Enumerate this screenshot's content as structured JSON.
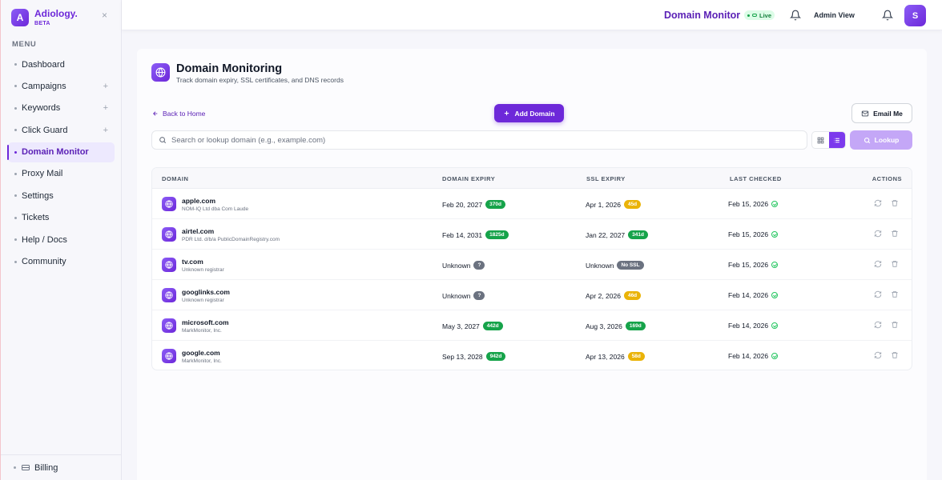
{
  "brand": {
    "logo_letter": "A",
    "name": "Adiology.",
    "badge": "BETA"
  },
  "sidebar": {
    "heading": "MENU",
    "items": [
      {
        "label": "Dashboard",
        "expandable": false,
        "active": false
      },
      {
        "label": "Campaigns",
        "expandable": true,
        "active": false
      },
      {
        "label": "Keywords",
        "expandable": true,
        "active": false
      },
      {
        "label": "Click Guard",
        "expandable": true,
        "active": false
      },
      {
        "label": "Domain Monitor",
        "expandable": false,
        "active": true
      },
      {
        "label": "Proxy Mail",
        "expandable": false,
        "active": false
      },
      {
        "label": "Settings",
        "expandable": false,
        "active": false
      },
      {
        "label": "Tickets",
        "expandable": false,
        "active": false
      },
      {
        "label": "Help / Docs",
        "expandable": false,
        "active": false
      },
      {
        "label": "Community",
        "expandable": false,
        "active": false
      }
    ],
    "bottom_label": "Billing",
    "plus_symbol": "+",
    "close_symbol": "×"
  },
  "topbar": {
    "title": "Domain Monitor",
    "live_label": "Live",
    "admin_label": "Admin View",
    "avatar_letter": "S"
  },
  "page": {
    "title": "Domain Monitoring",
    "subtitle": "Track domain expiry, SSL certificates, and DNS records",
    "back_label": "Back to Home",
    "add_label": "Add Domain",
    "email_label": "Email Me",
    "search_placeholder": "Search or lookup domain (e.g., example.com)",
    "lookup_label": "Lookup",
    "view_mode": "list"
  },
  "table": {
    "headers": {
      "domain": "DOMAIN",
      "domain_expiry": "DOMAIN EXPIRY",
      "ssl_expiry": "SSL EXPIRY",
      "last_checked": "LAST CHECKED",
      "actions": "ACTIONS"
    },
    "rows": [
      {
        "domain": "apple.com",
        "registrar": "NOM-IQ Ltd dba Com Laude",
        "domain_expiry": "Feb 20, 2027",
        "domain_badge": "370d",
        "domain_badge_color": "green",
        "ssl_expiry": "Apr 1, 2026",
        "ssl_badge": "45d",
        "ssl_badge_color": "yellow",
        "last_checked": "Feb 15, 2026"
      },
      {
        "domain": "airtel.com",
        "registrar": "PDR Ltd. d/b/a PublicDomainRegistry.com",
        "domain_expiry": "Feb 14, 2031",
        "domain_badge": "1825d",
        "domain_badge_color": "green",
        "ssl_expiry": "Jan 22, 2027",
        "ssl_badge": "341d",
        "ssl_badge_color": "green",
        "last_checked": "Feb 15, 2026"
      },
      {
        "domain": "tv.com",
        "registrar": "Unknown registrar",
        "domain_expiry": "Unknown",
        "domain_badge": "?",
        "domain_badge_color": "grey",
        "ssl_expiry": "Unknown",
        "ssl_badge": "No SSL",
        "ssl_badge_color": "grey",
        "last_checked": "Feb 15, 2026"
      },
      {
        "domain": "googlinks.com",
        "registrar": "Unknown registrar",
        "domain_expiry": "Unknown",
        "domain_badge": "?",
        "domain_badge_color": "grey",
        "ssl_expiry": "Apr 2, 2026",
        "ssl_badge": "46d",
        "ssl_badge_color": "yellow",
        "last_checked": "Feb 14, 2026"
      },
      {
        "domain": "microsoft.com",
        "registrar": "MarkMonitor, Inc.",
        "domain_expiry": "May 3, 2027",
        "domain_badge": "442d",
        "domain_badge_color": "green",
        "ssl_expiry": "Aug 3, 2026",
        "ssl_badge": "169d",
        "ssl_badge_color": "green",
        "last_checked": "Feb 14, 2026"
      },
      {
        "domain": "google.com",
        "registrar": "MarkMonitor, Inc.",
        "domain_expiry": "Sep 13, 2028",
        "domain_badge": "942d",
        "domain_badge_color": "green",
        "ssl_expiry": "Apr 13, 2026",
        "ssl_badge": "58d",
        "ssl_badge_color": "yellow",
        "last_checked": "Feb 14, 2026"
      }
    ]
  },
  "colors": {
    "accent": "#6d28d9",
    "accent_light": "#ede9fe",
    "success": "#16a34a",
    "warning": "#eab308",
    "neutral": "#6b7280"
  },
  "icons": {
    "brand": "logo-icon",
    "close": "close-icon",
    "bell": "bell-icon",
    "globe": "globe-icon",
    "back": "arrow-left-icon",
    "plus": "plus-icon",
    "mail": "mail-icon",
    "search": "search-icon",
    "grid": "grid-view-icon",
    "list": "list-view-icon",
    "refresh": "refresh-icon",
    "trash": "trash-icon",
    "check": "check-circle-icon",
    "card": "credit-card-icon"
  }
}
